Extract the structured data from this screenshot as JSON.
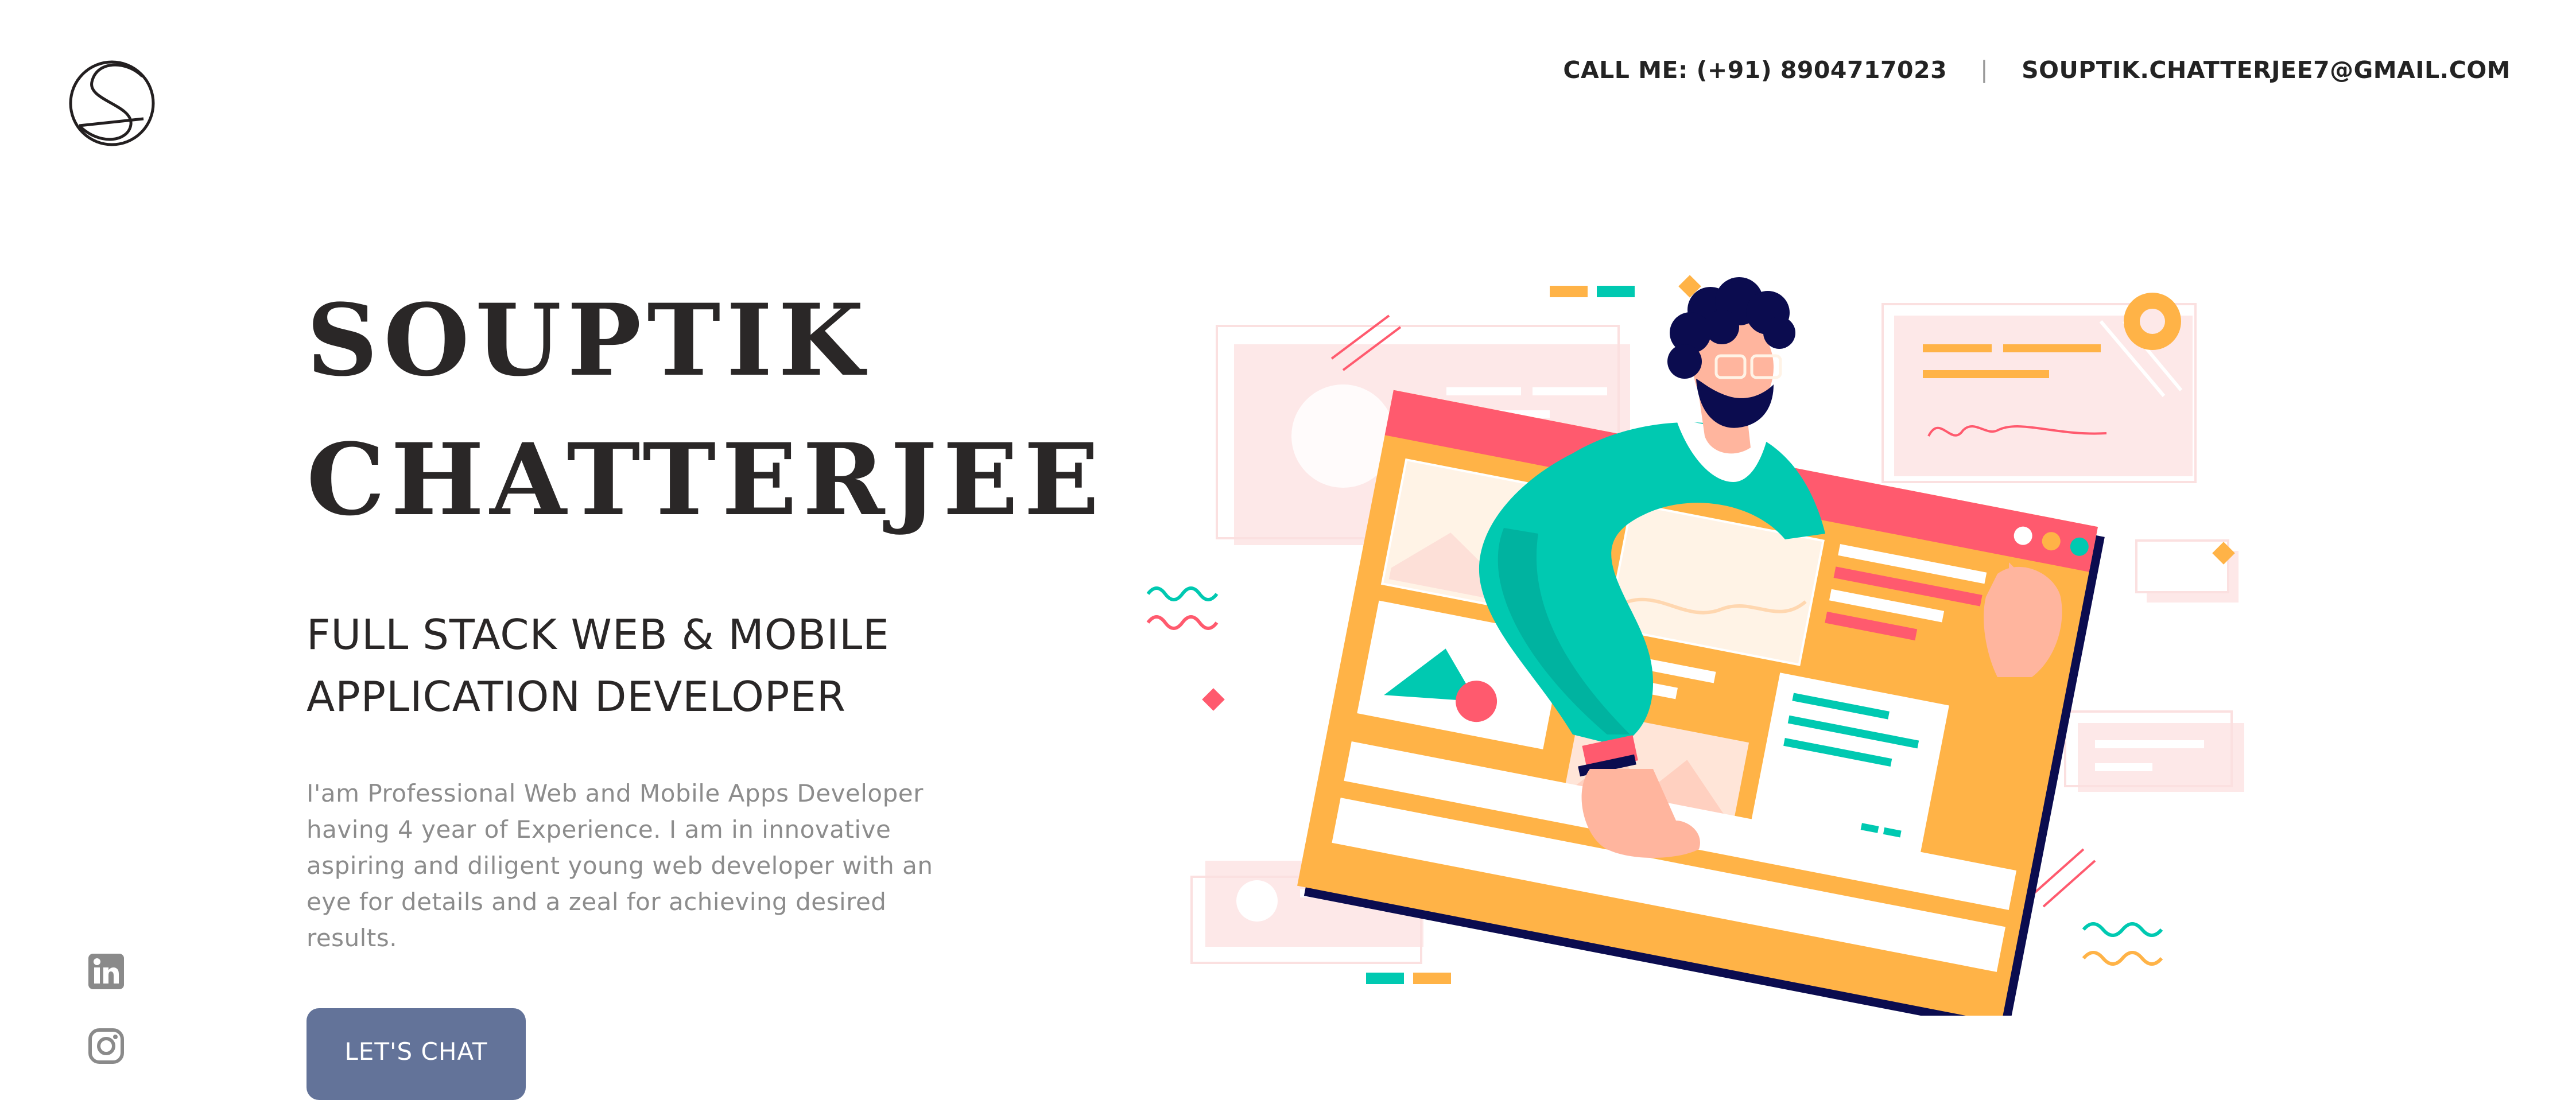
{
  "header": {
    "phone_text": "CALL ME: (+91) 8904717023",
    "separator": "|",
    "email_text": "SOUPTIK.CHATTERJEE7@GMAIL.COM",
    "logo_icon": "s-circle-logo"
  },
  "hero": {
    "name_line1": "SOUPTIK",
    "name_line2": "CHATTERJEE",
    "role_line1": "FULL STACK WEB & MOBILE",
    "role_line2": "APPLICATION DEVELOPER",
    "bio": "I'am Professional Web and Mobile Apps Developer having 4 year of Experience. I am in innovative aspiring and diligent young web developer with an eye for details and a zeal for achieving desired results.",
    "cta_label": "LET'S CHAT"
  },
  "social": {
    "linkedin_icon": "linkedin-icon",
    "instagram_icon": "instagram-icon"
  },
  "colors": {
    "cta_background": "#637399",
    "heading": "#2a2727",
    "body_text": "#8c8c8c",
    "accent_orange": "#ffb347",
    "accent_pink": "#ff5a6e",
    "accent_teal": "#00c9b1",
    "navy": "#0b0c4f"
  }
}
